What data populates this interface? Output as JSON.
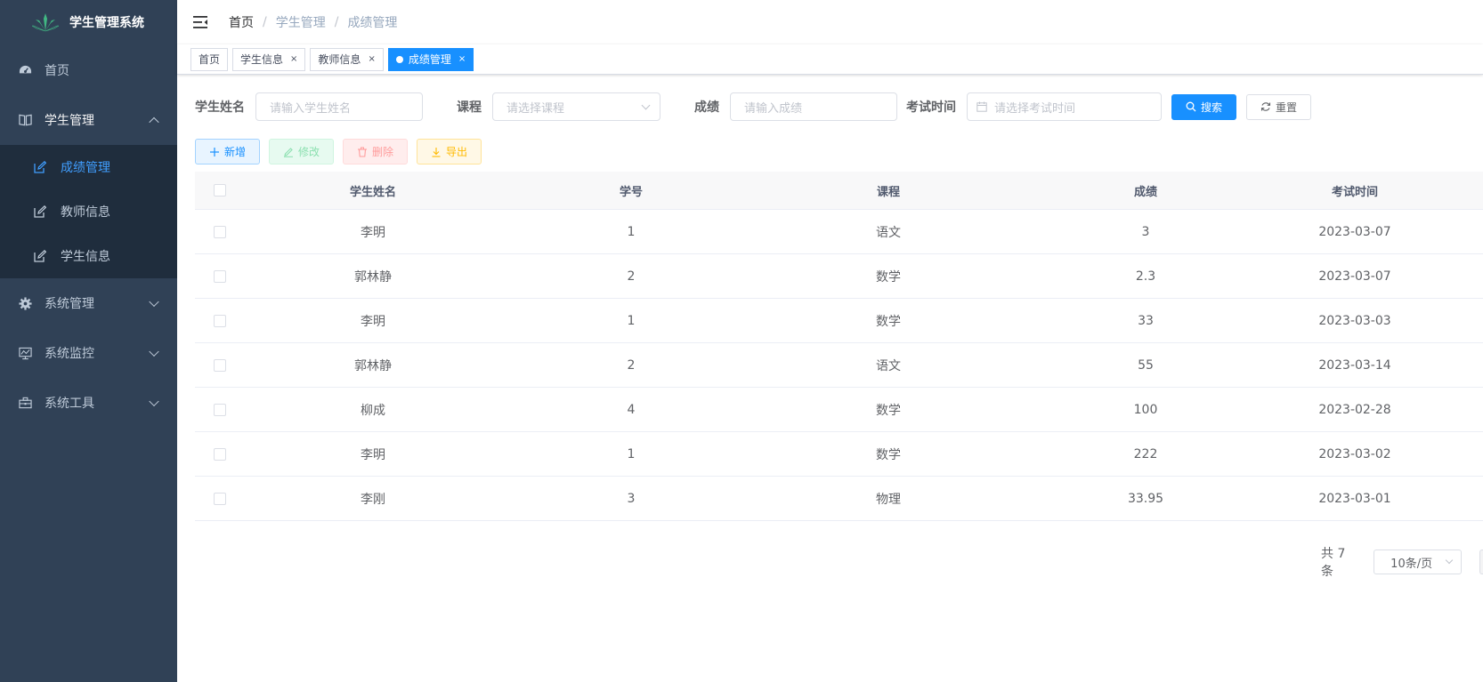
{
  "app": {
    "title": "学生管理系统"
  },
  "sidebar": {
    "home": "首页",
    "student_mgmt": "学生管理",
    "sub_items": [
      "成绩管理",
      "教师信息",
      "学生信息"
    ],
    "system_mgmt": "系统管理",
    "system_monitor": "系统监控",
    "system_tools": "系统工具"
  },
  "breadcrumb": [
    "首页",
    "学生管理",
    "成绩管理"
  ],
  "breadcrumb_sep": "/",
  "tags": [
    {
      "label": "首页",
      "closable": false,
      "active": false
    },
    {
      "label": "学生信息",
      "closable": true,
      "active": false
    },
    {
      "label": "教师信息",
      "closable": true,
      "active": false
    },
    {
      "label": "成绩管理",
      "closable": true,
      "active": true
    }
  ],
  "tag_close": "×",
  "search": {
    "name_label": "学生姓名",
    "name_placeholder": "请输入学生姓名",
    "course_label": "课程",
    "course_placeholder": "请选择课程",
    "score_label": "成绩",
    "score_placeholder": "请输入成绩",
    "time_label": "考试时间",
    "time_placeholder": "请选择考试时间",
    "search_button": "搜索",
    "reset_button": "重置"
  },
  "actions": {
    "add": "新增",
    "edit": "修改",
    "delete": "删除",
    "export": "导出"
  },
  "table": {
    "columns": [
      "学生姓名",
      "学号",
      "课程",
      "成绩",
      "考试时间"
    ],
    "rows": [
      [
        "李明",
        "1",
        "语文",
        "3",
        "2023-03-07"
      ],
      [
        "郭林静",
        "2",
        "数学",
        "2.3",
        "2023-03-07"
      ],
      [
        "李明",
        "1",
        "数学",
        "33",
        "2023-03-03"
      ],
      [
        "郭林静",
        "2",
        "语文",
        "55",
        "2023-03-14"
      ],
      [
        "柳成",
        "4",
        "数学",
        "100",
        "2023-02-28"
      ],
      [
        "李明",
        "1",
        "数学",
        "222",
        "2023-03-02"
      ],
      [
        "李刚",
        "3",
        "物理",
        "33.95",
        "2023-03-01"
      ]
    ]
  },
  "pagination": {
    "total": "共 7 条",
    "page_size": "10条/页"
  },
  "colors": {
    "sidebar_bg": "#304156",
    "submenu_bg": "#1f2d3d",
    "primary": "#1890ff",
    "active_menu": "#409eff"
  }
}
